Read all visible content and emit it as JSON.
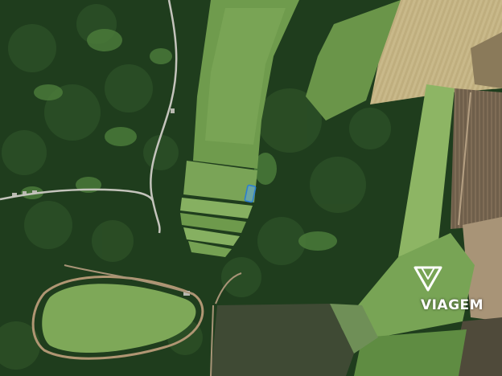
{
  "map": {
    "type": "satellite",
    "watermark": {
      "brand": "VIAGEM",
      "icon": "diamond-logo-icon"
    },
    "marker": {
      "icon": "parcel-marker",
      "color": "#3b8fd6"
    },
    "colors": {
      "forest_dark": "#1d3a1c",
      "forest": "#2e5127",
      "meadow": "#6e9a4c",
      "meadow_light": "#8db564",
      "wheat": "#c9b98a",
      "plowed": "#7d6b55",
      "road": "#b8b8b0"
    }
  }
}
